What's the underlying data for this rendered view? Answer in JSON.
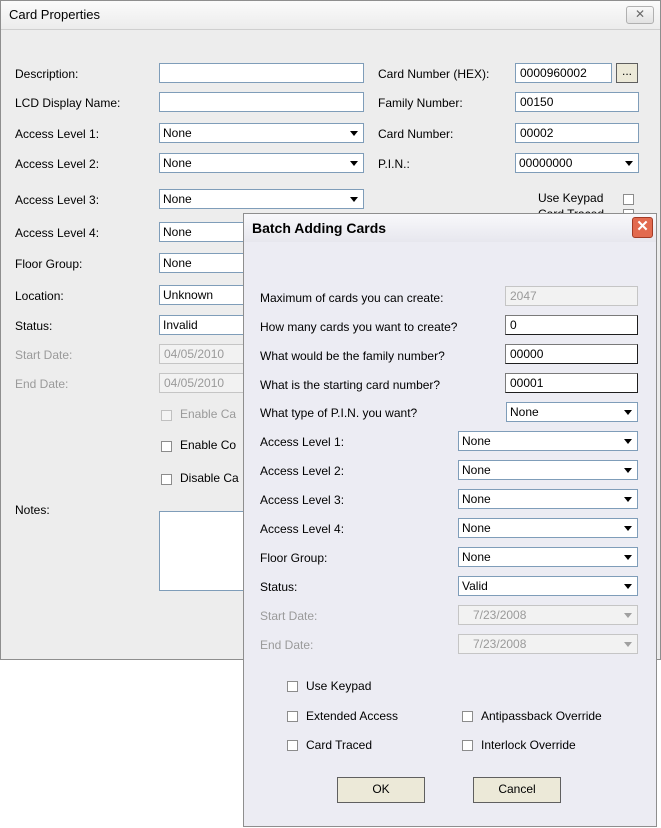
{
  "card_properties": {
    "title": "Card Properties",
    "close_glyph": "✕",
    "labels": {
      "description": "Description:",
      "lcd_display_name": "LCD Display Name:",
      "access_level_1": "Access Level 1:",
      "access_level_2": "Access Level 2:",
      "access_level_3": "Access Level 3:",
      "access_level_4": "Access Level 4:",
      "floor_group": "Floor Group:",
      "location": "Location:",
      "status": "Status:",
      "start_date": "Start Date:",
      "end_date": "End Date:",
      "notes": "Notes:",
      "card_number_hex": "Card Number (HEX):",
      "family_number": "Family Number:",
      "card_number": "Card Number:",
      "pin": "P.I.N.:",
      "use_keypad": "Use Keypad",
      "card_traced_partial": "Card Traced"
    },
    "values": {
      "description": "",
      "lcd_display_name": "",
      "access_level_1": "None",
      "access_level_2": "None",
      "access_level_3": "None",
      "access_level_4": "None",
      "floor_group": "None",
      "location": "Unknown",
      "status": "Invalid",
      "start_date": "04/05/2010",
      "end_date": "04/05/2010",
      "card_number_hex": "0000960002",
      "family_number": "00150",
      "card_number": "00002",
      "pin": "00000000"
    },
    "checks": {
      "enable_1": "Enable Ca",
      "enable_2": "Enable Co",
      "disable": "Disable Ca"
    },
    "browse_glyph": "..."
  },
  "batch": {
    "title": "Batch Adding Cards",
    "close_glyph": "✕",
    "labels": {
      "max_cards": "Maximum of cards you can create:",
      "how_many": "How many cards you want to create?",
      "family_number": "What would be the family number?",
      "starting_number": "What is the starting card number?",
      "pin_type": "What type of P.I.N. you want?",
      "access_level_1": "Access Level 1:",
      "access_level_2": "Access Level 2:",
      "access_level_3": "Access Level 3:",
      "access_level_4": "Access Level 4:",
      "floor_group": "Floor Group:",
      "status": "Status:",
      "start_date": "Start Date:",
      "end_date": "End Date:"
    },
    "values": {
      "max_cards": "2047",
      "how_many": "0",
      "family_number": "00000",
      "starting_number": "00001",
      "pin_type": "None",
      "access_level_1": "None",
      "access_level_2": "None",
      "access_level_3": "None",
      "access_level_4": "None",
      "floor_group": "None",
      "status": "Valid",
      "start_date": "7/23/2008",
      "end_date": "7/23/2008"
    },
    "checks": {
      "use_keypad": "Use Keypad",
      "extended_access": "Extended Access",
      "antipassback_override": "Antipassback Override",
      "card_traced": "Card Traced",
      "interlock_override": "Interlock Override"
    },
    "buttons": {
      "ok": "OK",
      "cancel": "Cancel"
    }
  }
}
